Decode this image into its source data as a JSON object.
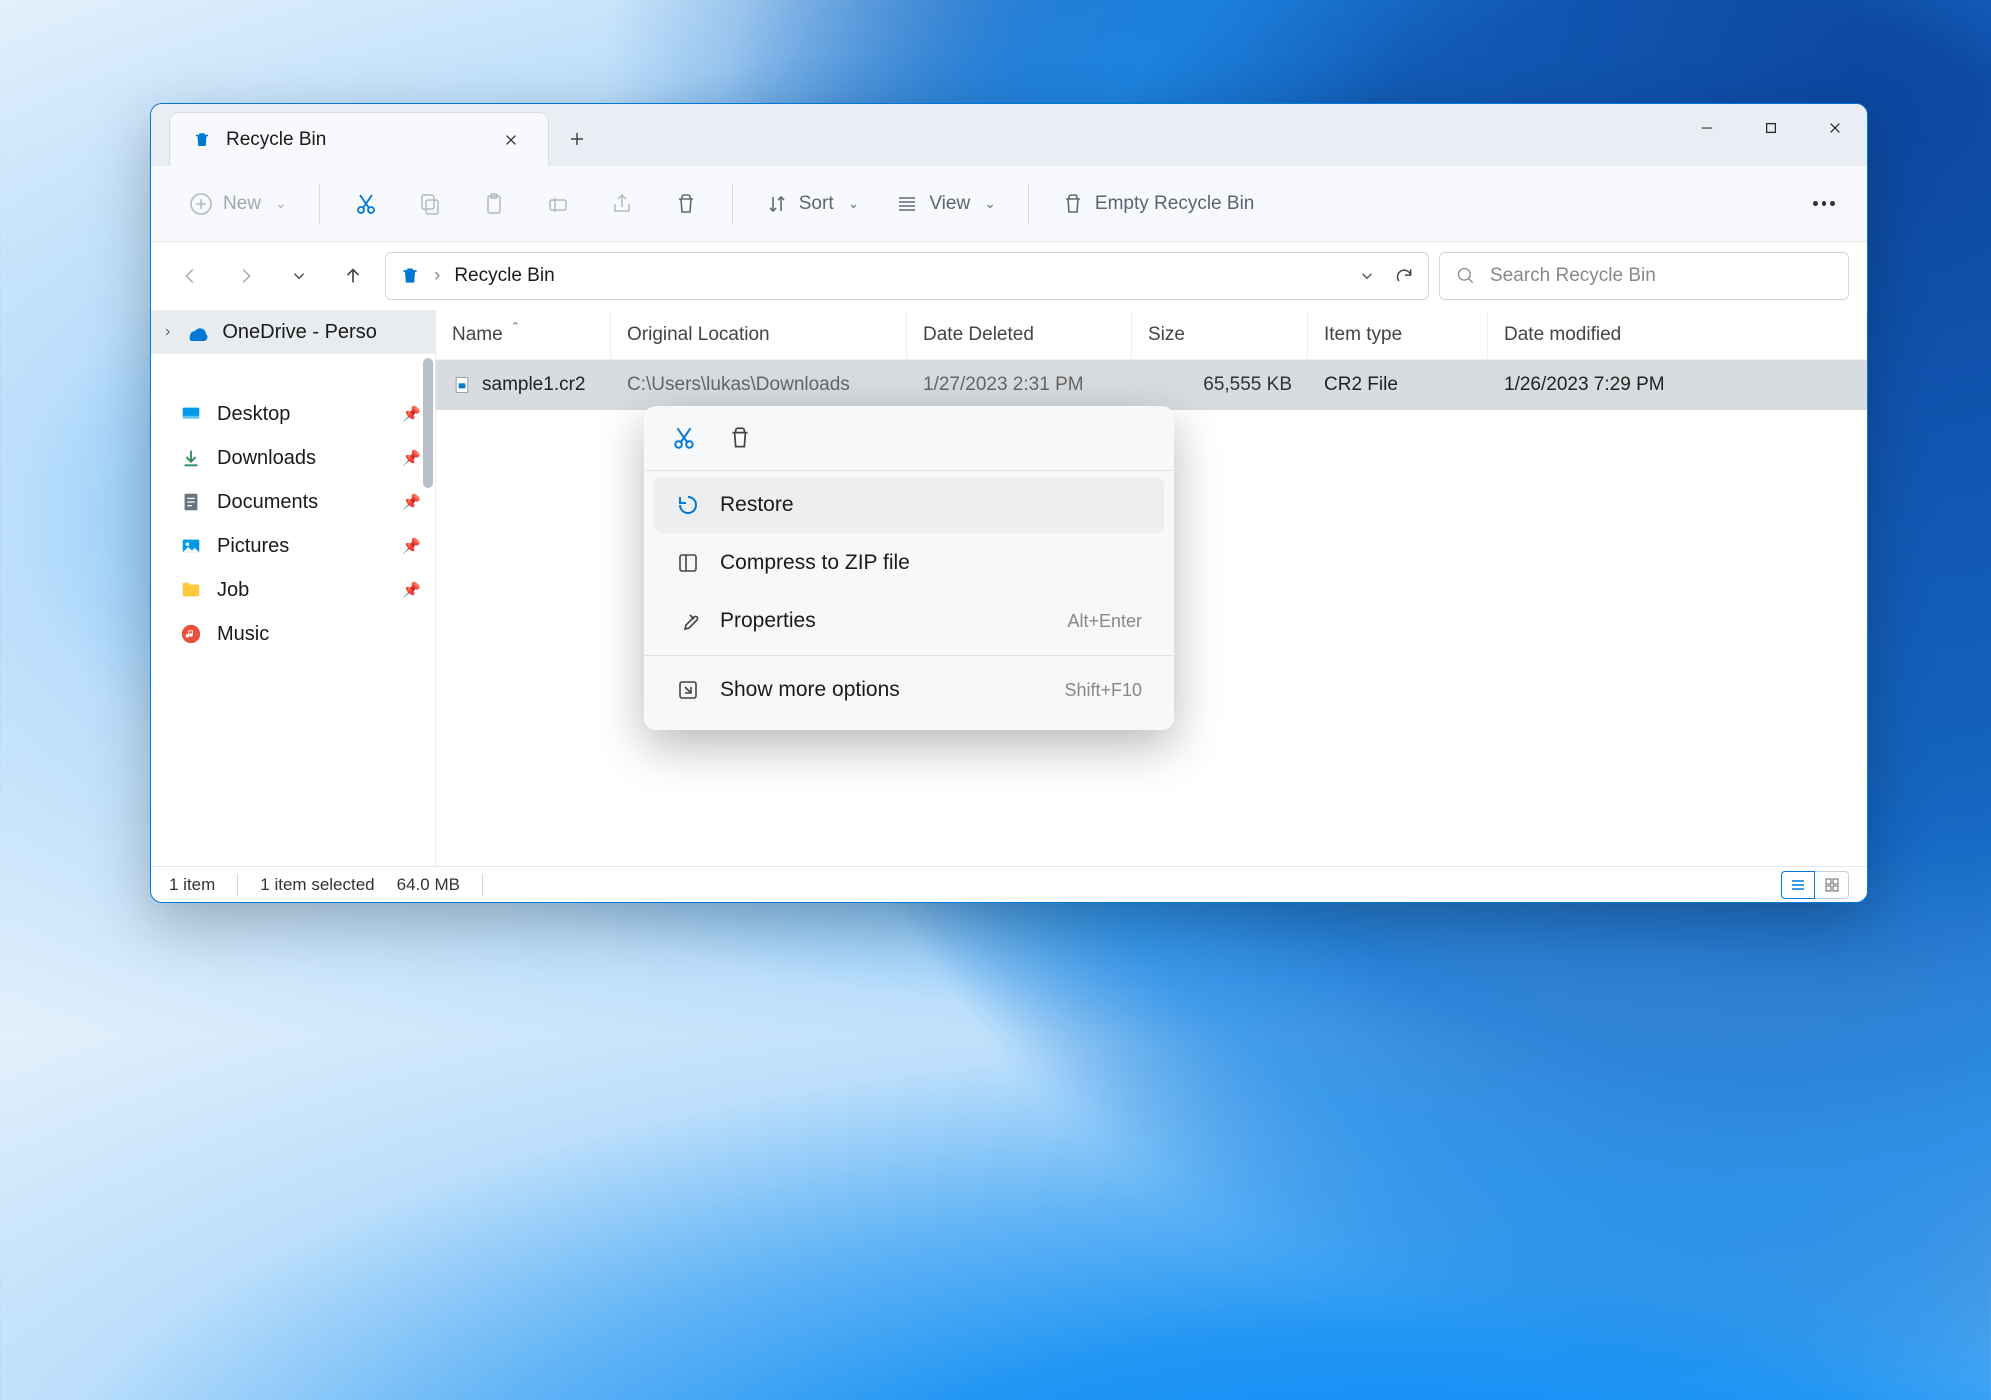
{
  "window": {
    "title": "Recycle Bin"
  },
  "toolbar": {
    "new": "New",
    "sort": "Sort",
    "view": "View",
    "empty": "Empty Recycle Bin"
  },
  "address": {
    "location": "Recycle Bin",
    "search_placeholder": "Search Recycle Bin"
  },
  "sidebar": {
    "onedrive": "OneDrive - Perso",
    "desktop": "Desktop",
    "downloads": "Downloads",
    "documents": "Documents",
    "pictures": "Pictures",
    "job": "Job",
    "music": "Music"
  },
  "columns": {
    "name": "Name",
    "location": "Original Location",
    "deleted": "Date Deleted",
    "size": "Size",
    "type": "Item type",
    "modified": "Date modified"
  },
  "file": {
    "name": "sample1.cr2",
    "location": "C:\\Users\\lukas\\Downloads",
    "deleted": "1/27/2023 2:31 PM",
    "size": "65,555 KB",
    "type": "CR2 File",
    "modified": "1/26/2023 7:29 PM"
  },
  "context": {
    "restore": "Restore",
    "compress": "Compress to ZIP file",
    "properties": "Properties",
    "properties_shortcut": "Alt+Enter",
    "more": "Show more options",
    "more_shortcut": "Shift+F10"
  },
  "status": {
    "items": "1 item",
    "selected": "1 item selected",
    "size": "64.0 MB"
  }
}
